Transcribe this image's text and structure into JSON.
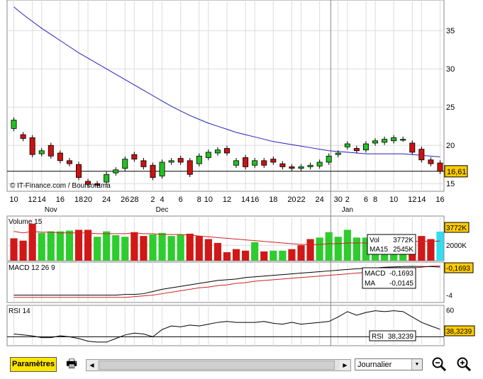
{
  "chart_data": [
    {
      "type": "candlestick",
      "panel": "price",
      "ylim": [
        14,
        39
      ],
      "y_ticks": [
        "35",
        "30",
        "25",
        "20",
        "15"
      ],
      "last_price_label": "16,61",
      "last_price": 16.61,
      "source_label": "© IT-Finance.com / Boursorama",
      "x_labels": [
        "10",
        "12",
        "14",
        "16",
        "18",
        "20",
        "24",
        "26",
        "28",
        "2",
        "4",
        "6",
        "8",
        "10",
        "12",
        "14",
        "16",
        "18",
        "20",
        "22",
        "24",
        "30",
        "2",
        "6",
        "8",
        "10",
        "12",
        "14",
        "16"
      ],
      "month_labels": [
        "Nov",
        "Dec",
        "Jan"
      ],
      "candles": [
        {
          "o": 22.2,
          "c": 23.3
        },
        {
          "o": 21.4,
          "c": 20.9
        },
        {
          "o": 21.0,
          "c": 18.8
        },
        {
          "o": 18.9,
          "c": 19.3
        },
        {
          "o": 20.0,
          "c": 18.6
        },
        {
          "o": 19.0,
          "c": 18.0
        },
        {
          "o": 18.0,
          "c": 17.6
        },
        {
          "o": 17.5,
          "c": 15.8
        },
        {
          "o": 15.3,
          "c": 14.9
        },
        {
          "o": 15.0,
          "c": 14.8
        },
        {
          "o": 15.2,
          "c": 16.2
        },
        {
          "o": 16.4,
          "c": 16.8
        },
        {
          "o": 17.0,
          "c": 18.2
        },
        {
          "o": 18.8,
          "c": 18.2
        },
        {
          "o": 18.0,
          "c": 17.2
        },
        {
          "o": 17.4,
          "c": 15.8
        },
        {
          "o": 16.0,
          "c": 17.8
        },
        {
          "o": 17.8,
          "c": 18.0
        },
        {
          "o": 18.3,
          "c": 17.8
        },
        {
          "o": 18.0,
          "c": 16.2
        },
        {
          "o": 17.6,
          "c": 18.6
        },
        {
          "o": 18.4,
          "c": 19.1
        },
        {
          "o": 19.0,
          "c": 19.4
        },
        {
          "o": 19.6,
          "c": 19.0
        },
        {
          "o": 17.4,
          "c": 18.0
        },
        {
          "o": 18.4,
          "c": 17.2
        },
        {
          "o": 17.4,
          "c": 18.0
        },
        {
          "o": 18.0,
          "c": 17.4
        },
        {
          "o": 18.2,
          "c": 17.8
        },
        {
          "o": 17.6,
          "c": 17.2
        },
        {
          "o": 17.2,
          "c": 17.0
        },
        {
          "o": 17.0,
          "c": 17.2
        },
        {
          "o": 17.2,
          "c": 17.4
        },
        {
          "o": 17.3,
          "c": 17.8
        },
        {
          "o": 17.8,
          "c": 18.6
        },
        {
          "o": 18.8,
          "c": 19.0
        },
        {
          "o": 19.8,
          "c": 20.2
        },
        {
          "o": 19.6,
          "c": 19.3
        },
        {
          "o": 19.4,
          "c": 20.2
        },
        {
          "o": 20.3,
          "c": 20.6
        },
        {
          "o": 20.4,
          "c": 20.8
        },
        {
          "o": 20.6,
          "c": 21.0
        },
        {
          "o": 20.8,
          "c": 20.8
        },
        {
          "o": 20.3,
          "c": 19.1
        },
        {
          "o": 19.5,
          "c": 18.1
        },
        {
          "o": 18.1,
          "c": 17.6
        },
        {
          "o": 17.7,
          "c": 16.6
        }
      ],
      "ma": [
        38.1,
        37.1,
        36.2,
        35.3,
        34.5,
        33.7,
        32.9,
        32.1,
        31.4,
        30.7,
        30.0,
        29.3,
        28.6,
        27.9,
        27.2,
        26.5,
        25.8,
        25.1,
        24.5,
        23.9,
        23.4,
        22.9,
        22.5,
        22.1,
        21.7,
        21.4,
        21.1,
        20.8,
        20.5,
        20.3,
        20.1,
        19.9,
        19.7,
        19.5,
        19.3,
        19.2,
        19.1,
        19.0,
        18.9,
        18.9,
        18.9,
        18.9,
        18.9,
        18.8,
        18.7,
        18.6,
        18.5
      ]
    },
    {
      "type": "bar",
      "panel": "volume",
      "title": "Volume 15",
      "y_ticks": [
        "2000K"
      ],
      "vol_label": "Vol",
      "vol_value": "3772K",
      "ma_label": "MA15",
      "ma_value": "2545K",
      "right_label": "3772K",
      "colors": [
        "r",
        "r",
        "r",
        "g",
        "g",
        "g",
        "g",
        "r",
        "r",
        "g",
        "g",
        "g",
        "g",
        "r",
        "r",
        "g",
        "g",
        "g",
        "g",
        "r",
        "r",
        "r",
        "r",
        "r",
        "r",
        "r",
        "g",
        "r",
        "g",
        "g",
        "r",
        "r",
        "r",
        "g",
        "g",
        "g",
        "g",
        "g",
        "g",
        "g",
        "g",
        "g",
        "g",
        "r",
        "r",
        "r",
        "c"
      ],
      "values": [
        2.9,
        2.6,
        4.8,
        3.6,
        3.8,
        3.8,
        3.9,
        4.0,
        4.0,
        3.1,
        3.8,
        3.3,
        3.1,
        3.7,
        3.2,
        3.4,
        3.6,
        3.2,
        3.4,
        3.5,
        3.2,
        2.8,
        2.3,
        1.1,
        1.5,
        1.3,
        2.4,
        1.2,
        1.3,
        1.3,
        1.5,
        2.0,
        2.8,
        3.0,
        3.7,
        3.1,
        4.0,
        3.0,
        3.0,
        2.9,
        2.9,
        2.9,
        2.9,
        2.9,
        3.2,
        2.8,
        3.772
      ],
      "ma": [
        3.8,
        3.6,
        3.8,
        3.7,
        3.7,
        3.6,
        3.6,
        3.6,
        3.6,
        3.5,
        3.5,
        3.5,
        3.5,
        3.6,
        3.5,
        3.5,
        3.4,
        3.4,
        3.4,
        3.3,
        3.2,
        3.1,
        3.0,
        2.9,
        2.8,
        2.7,
        2.6,
        2.5,
        2.4,
        2.3,
        2.2,
        2.1,
        2.1,
        2.1,
        2.2,
        2.2,
        2.3,
        2.3,
        2.3,
        2.4,
        2.4,
        2.4,
        2.5,
        2.5,
        2.5,
        2.5,
        2.545
      ]
    },
    {
      "type": "line",
      "panel": "macd",
      "title": "MACD 12 26 9",
      "ylim": [
        -5,
        0.5
      ],
      "y_ticks": [
        "-4"
      ],
      "macd_label": "MACD",
      "macd_value": "-0,1693",
      "ma_label": "MA",
      "ma_value": "-0,0145",
      "right_label": "-0,1693",
      "macd": [
        -4.0,
        -4.0,
        -4.0,
        -4.0,
        -4.0,
        -4.0,
        -4.0,
        -4.0,
        -4.0,
        -4.0,
        -4.0,
        -4.0,
        -3.9,
        -3.9,
        -3.8,
        -3.5,
        -3.2,
        -3.0,
        -2.8,
        -2.6,
        -2.4,
        -2.2,
        -2.0,
        -1.9,
        -1.8,
        -1.6,
        -1.5,
        -1.4,
        -1.3,
        -1.2,
        -1.1,
        -1.0,
        -0.9,
        -0.8,
        -0.7,
        -0.6,
        -0.5,
        -0.4,
        -0.35,
        -0.3,
        -0.2,
        -0.15,
        -0.1,
        -0.08,
        -0.1,
        -0.12,
        -0.17
      ],
      "signal": [
        -4.3,
        -4.3,
        -4.3,
        -4.3,
        -4.3,
        -4.3,
        -4.3,
        -4.3,
        -4.3,
        -4.3,
        -4.3,
        -4.3,
        -4.3,
        -4.2,
        -4.1,
        -4.0,
        -3.8,
        -3.6,
        -3.4,
        -3.2,
        -3.0,
        -2.9,
        -2.7,
        -2.6,
        -2.4,
        -2.3,
        -2.1,
        -2.0,
        -1.9,
        -1.8,
        -1.7,
        -1.6,
        -1.5,
        -1.4,
        -1.3,
        -1.2,
        -1.1,
        -1.0,
        -0.9,
        -0.8,
        -0.6,
        -0.5,
        -0.4,
        -0.3,
        -0.2,
        -0.05,
        -0.015
      ]
    },
    {
      "type": "line",
      "panel": "rsi",
      "title": "RSI 14",
      "ylim": [
        20,
        65
      ],
      "y_ticks": [
        "60"
      ],
      "rsi_label": "RSI",
      "rsi_value": "38,3239",
      "right_label": "38,3239",
      "values": [
        33,
        32,
        31,
        29,
        29,
        31,
        30,
        28,
        25,
        24,
        24,
        28,
        32,
        34,
        33,
        30,
        38,
        42,
        41,
        43,
        42,
        44,
        46,
        47,
        46,
        46,
        46,
        47,
        45,
        44,
        46,
        44,
        45,
        46,
        47,
        52,
        58,
        54,
        57,
        59,
        58,
        59,
        58,
        52,
        46,
        42,
        38.3
      ]
    }
  ],
  "toolbar": {
    "params_label": "Paramètres",
    "period_value": "Journalier"
  },
  "colors": {
    "candle_up": "#22c022",
    "candle_down": "#cc1111",
    "volume_up": "#2ecc2e",
    "volume_down": "#d01818",
    "volume_last": "#33ddee",
    "ma_price": "#2222bb",
    "ma_volume": "#cc2222",
    "macd": "#000000",
    "macd_signal": "#cc2222",
    "rsi": "#000000",
    "label_bg": "#ffcc00"
  }
}
